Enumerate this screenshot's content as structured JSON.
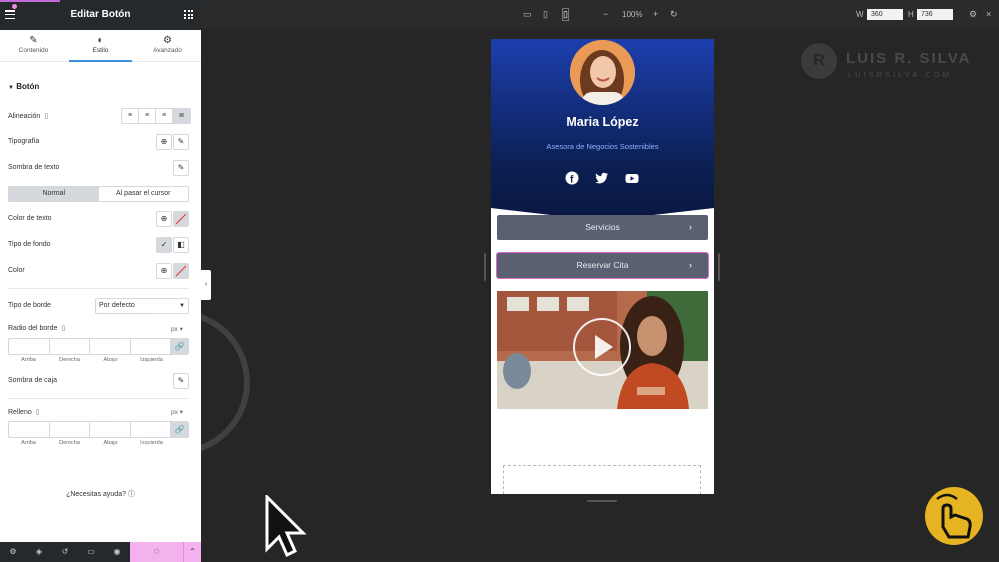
{
  "panel": {
    "title": "Editar Botón",
    "tabs": [
      {
        "label": "Contenido",
        "icon": "pencil-icon"
      },
      {
        "label": "Estilo",
        "icon": "contrast-icon"
      },
      {
        "label": "Avanzado",
        "icon": "gear-icon"
      }
    ],
    "section_title": "Botón",
    "labels": {
      "alignment": "Alineación",
      "typography": "Tipografía",
      "text_shadow": "Sombra de texto",
      "text_color": "Color de texto",
      "background_type": "Tipo de fondo",
      "color": "Color",
      "border_type": "Tipo de borde",
      "border_radius": "Radio del borde",
      "box_shadow": "Sombra de caja",
      "padding": "Relleno"
    },
    "state_toggle": {
      "normal": "Normal",
      "hover": "Al pasar el cursor"
    },
    "border_type_value": "Por defecto",
    "unit": "px",
    "dimension_labels": [
      "Arriba",
      "Derecha",
      "Abajo",
      "Izquierda"
    ],
    "help_text": "¿Necesitas ayuda?"
  },
  "toolbar": {
    "zoom": "100%",
    "width_label": "W",
    "width_value": "360",
    "height_label": "H",
    "height_value": "736"
  },
  "watermark": {
    "name": "LUIS R. SILVA",
    "site": "LUISRSILVA.COM"
  },
  "preview": {
    "name": "Maria López",
    "role": "Asesora de Negocios Sostenibles",
    "social_icons": [
      "facebook-icon",
      "twitter-icon",
      "youtube-icon"
    ],
    "buttons": [
      {
        "label": "Servicios"
      },
      {
        "label": "Reservar Cita"
      }
    ]
  },
  "colors": {
    "accent_pink": "#f3b2ee",
    "tab_underline": "#3b8fd6",
    "hero_top": "#1d3fae",
    "hero_bottom": "#0a1840",
    "button_bg": "#5a6072"
  }
}
